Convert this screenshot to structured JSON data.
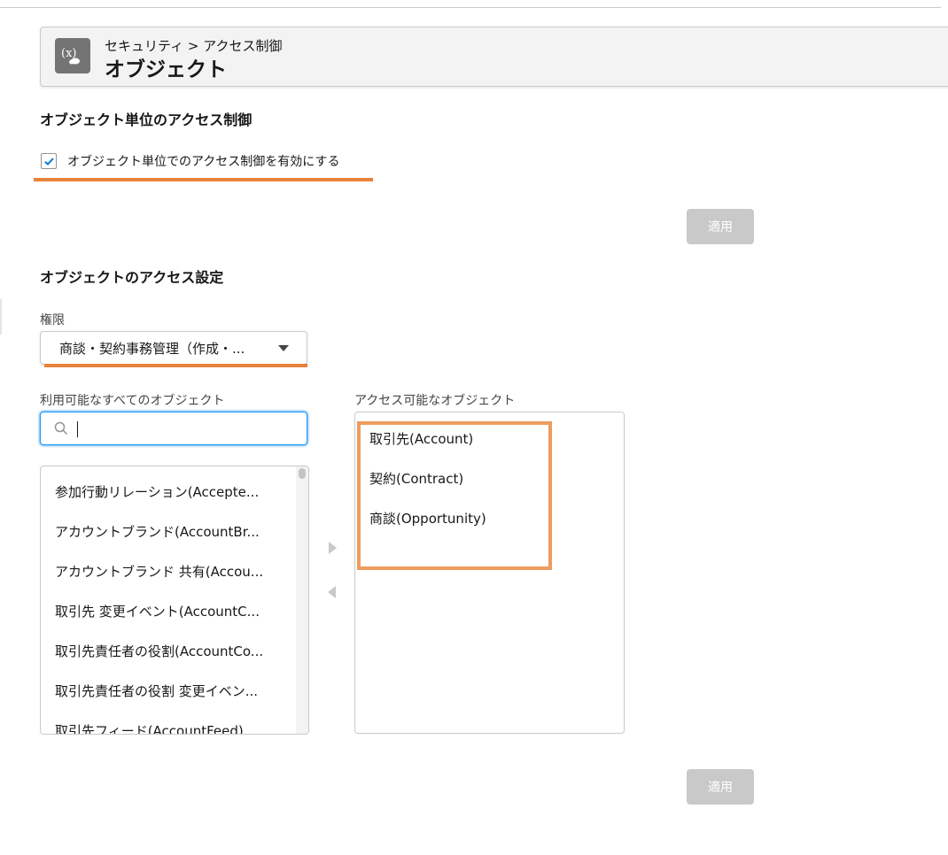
{
  "header": {
    "breadcrumb": "セキュリティ > アクセス制御",
    "title": "オブジェクト",
    "icon": "variable-icon"
  },
  "object_access_control": {
    "heading": "オブジェクト単位のアクセス制御",
    "checkbox_label": "オブジェクト単位でのアクセス制御を有効にする",
    "checked": true,
    "apply_label": "適用"
  },
  "object_access_settings": {
    "heading": "オブジェクトのアクセス設定",
    "permission_label": "権限",
    "permission_value": "商談・契約事務管理（作成・...",
    "available_label": "利用可能なすべてのオブジェクト",
    "search_value": "",
    "available_items": [
      "参加行動リレーション(Accepte...",
      "アカウントブランド(AccountBr...",
      "アカウントブランド 共有(Accou...",
      "取引先 変更イベント(AccountC...",
      "取引先責任者の役割(AccountCo...",
      "取引先責任者の役割 変更イベン...",
      "取引先フィード(AccountFeed)"
    ],
    "accessible_label": "アクセス可能なオブジェクト",
    "accessible_items": [
      "取引先(Account)",
      "契約(Contract)",
      "商談(Opportunity)"
    ],
    "apply_label": "適用"
  },
  "colors": {
    "accent_underline": "#e8823a",
    "highlight_border": "#ee9c5e",
    "focus_blue": "#1b96ff",
    "disabled_button": "#c9c9c9"
  }
}
